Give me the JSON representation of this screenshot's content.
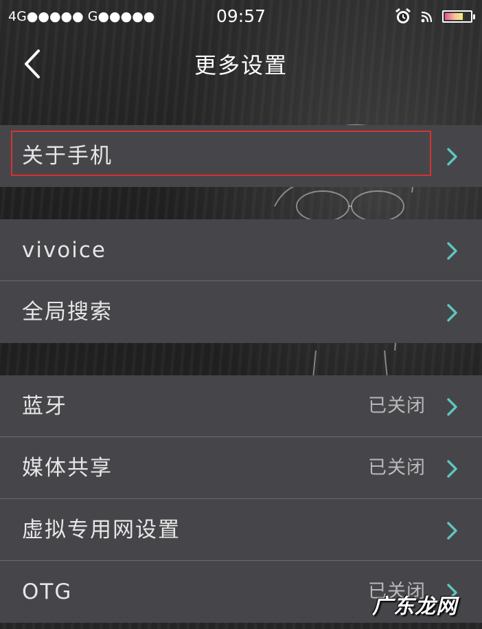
{
  "status_bar": {
    "carrier": "4G●●●●● G●●●●●",
    "time": "09:57",
    "icons": [
      "alarm-clock-icon",
      "wifi-icon",
      "battery-icon"
    ]
  },
  "nav": {
    "title": "更多设置",
    "back_icon": "chevron-left-icon"
  },
  "groups": [
    {
      "items": [
        {
          "label": "关于手机",
          "value": "",
          "highlighted": true
        }
      ]
    },
    {
      "items": [
        {
          "label": "vivoice",
          "value": ""
        },
        {
          "label": "全局搜索",
          "value": ""
        }
      ]
    },
    {
      "items": [
        {
          "label": "蓝牙",
          "value": "已关闭"
        },
        {
          "label": "媒体共享",
          "value": "已关闭"
        },
        {
          "label": "虚拟专用网设置",
          "value": ""
        },
        {
          "label": "OTG",
          "value": "已关闭"
        }
      ]
    }
  ],
  "colors": {
    "chevron": "#5ec6c0",
    "highlight_border": "#d83232",
    "row_bg": "#46464a"
  },
  "watermark": "广东龙网"
}
